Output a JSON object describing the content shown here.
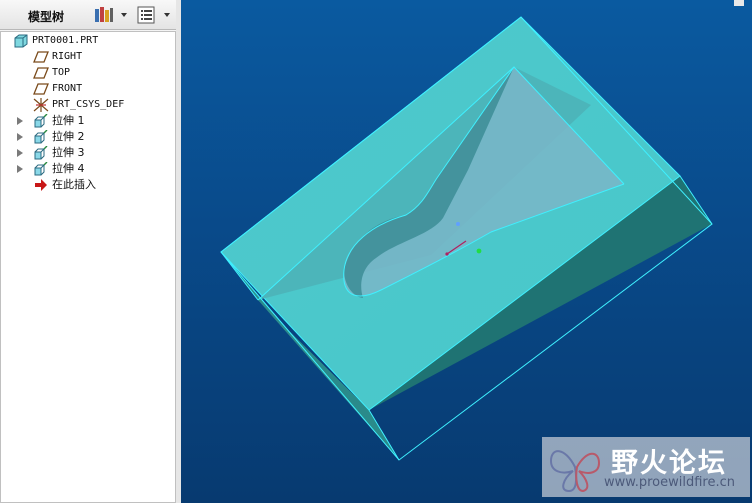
{
  "panel": {
    "title": "模型树"
  },
  "tree": {
    "root": "PRT0001.PRT",
    "items": [
      {
        "label": "RIGHT",
        "type": "datum-plane"
      },
      {
        "label": "TOP",
        "type": "datum-plane"
      },
      {
        "label": "FRONT",
        "type": "datum-plane"
      },
      {
        "label": "PRT_CSYS_DEF",
        "type": "csys"
      },
      {
        "label": "拉伸 1",
        "type": "extrude"
      },
      {
        "label": "拉伸 2",
        "type": "extrude"
      },
      {
        "label": "拉伸 3",
        "type": "extrude"
      },
      {
        "label": "拉伸 4",
        "type": "extrude"
      },
      {
        "label": "在此插入",
        "type": "insert-here"
      }
    ]
  },
  "watermark": {
    "text": "野火论坛",
    "url": "www.proewildfire.cn"
  },
  "colors": {
    "model": "#4ecfd0",
    "model_edge": "#3ff0ff",
    "background": "#0a4f92",
    "insert_arrow": "#c81818"
  }
}
